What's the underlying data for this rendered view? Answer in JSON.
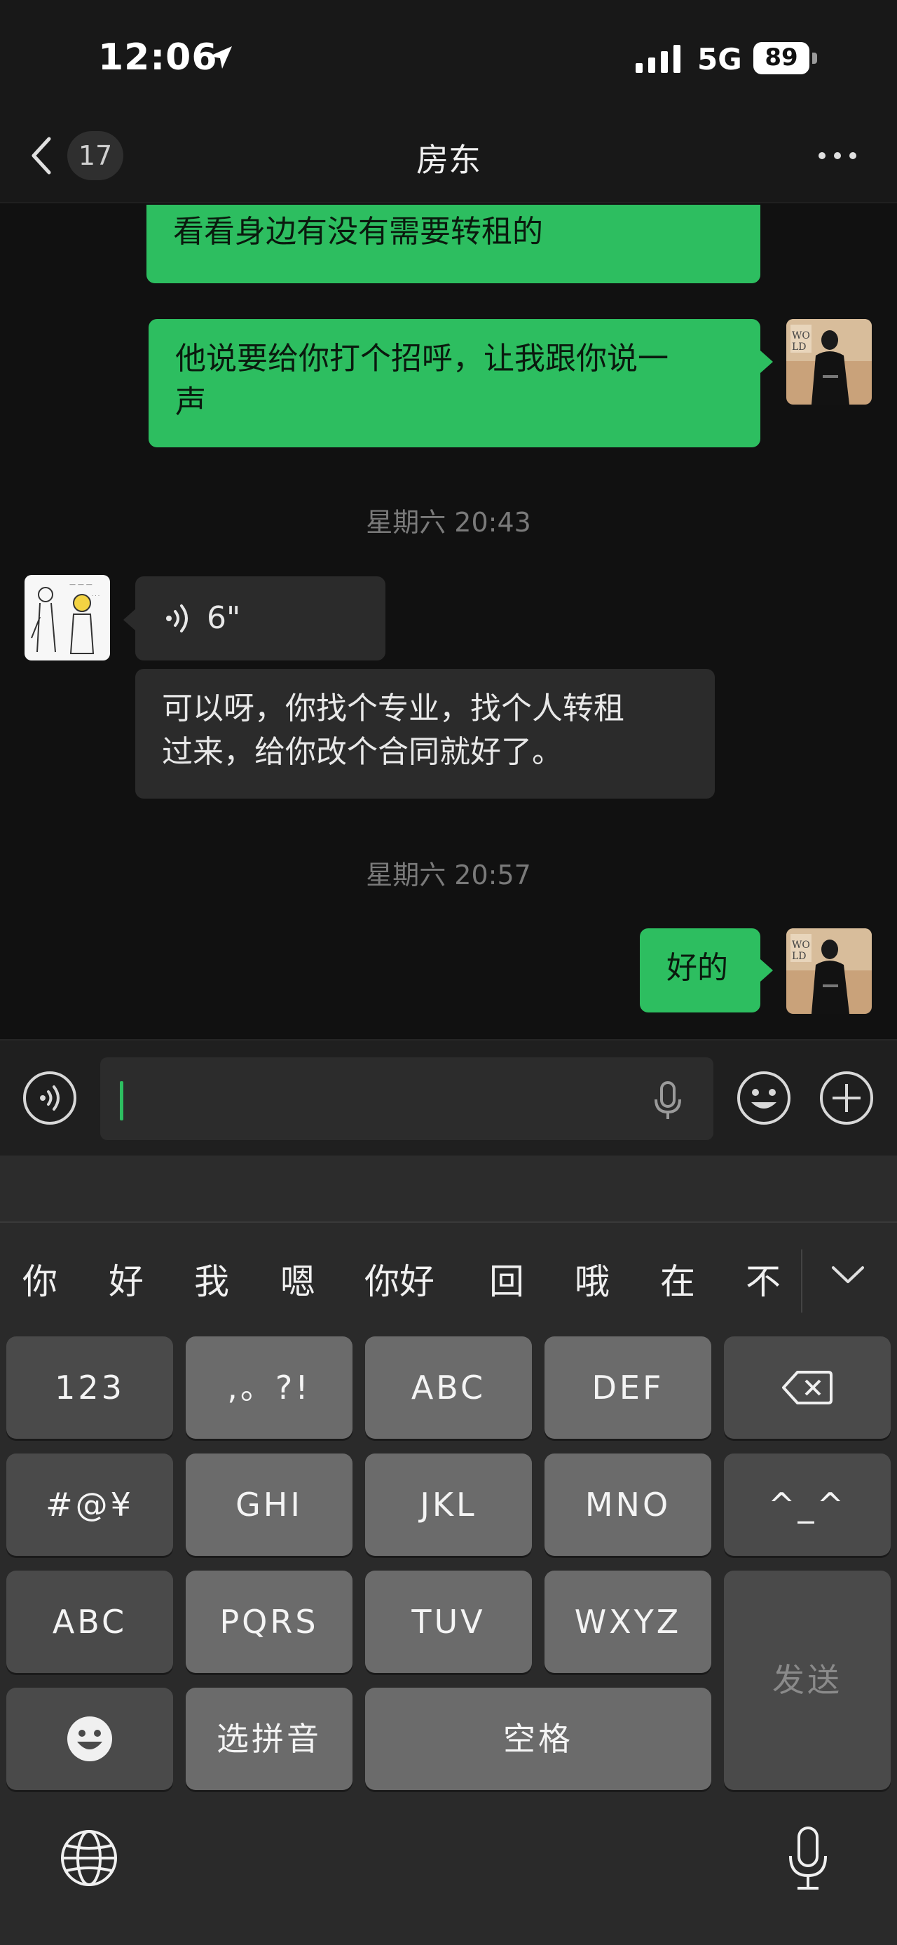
{
  "status": {
    "time": "12:06",
    "network": "5G",
    "battery": "89"
  },
  "nav": {
    "badge": "17",
    "title": "房东"
  },
  "messages": {
    "m1": "大哥说了他帮租我转租的客户，我也\n看看身边有没有需要转租的",
    "m2": "他说要给你打个招呼，让我跟你说一\n声",
    "ts1": "星期六 20:43",
    "voice": "6\"",
    "m3": "可以呀，你找个专业，找个人转租\n过来，给你改个合同就好了。",
    "ts2": "星期六 20:57",
    "m4": "好的"
  },
  "candidates": [
    "你",
    "好",
    "我",
    "嗯",
    "你好",
    "回",
    "哦",
    "在",
    "不"
  ],
  "keys": {
    "r1": [
      "123",
      ",。?!",
      "ABC",
      "DEF"
    ],
    "r2": [
      "#@¥",
      "GHI",
      "JKL",
      "MNO",
      "^_^"
    ],
    "r3": [
      "ABC",
      "PQRS",
      "TUV",
      "WXYZ"
    ],
    "r4": [
      "选拼音",
      "空格"
    ],
    "send": "发送"
  },
  "colors": {
    "accent": "#2dbe60",
    "background": "#111111"
  },
  "icons": [
    "location-arrow-icon",
    "signal-icon",
    "battery-icon",
    "chevron-left-icon",
    "more-icon",
    "voice-icon",
    "mic-icon",
    "emoji-icon",
    "plus-icon",
    "backspace-icon",
    "globe-icon",
    "chevron-down-icon"
  ]
}
